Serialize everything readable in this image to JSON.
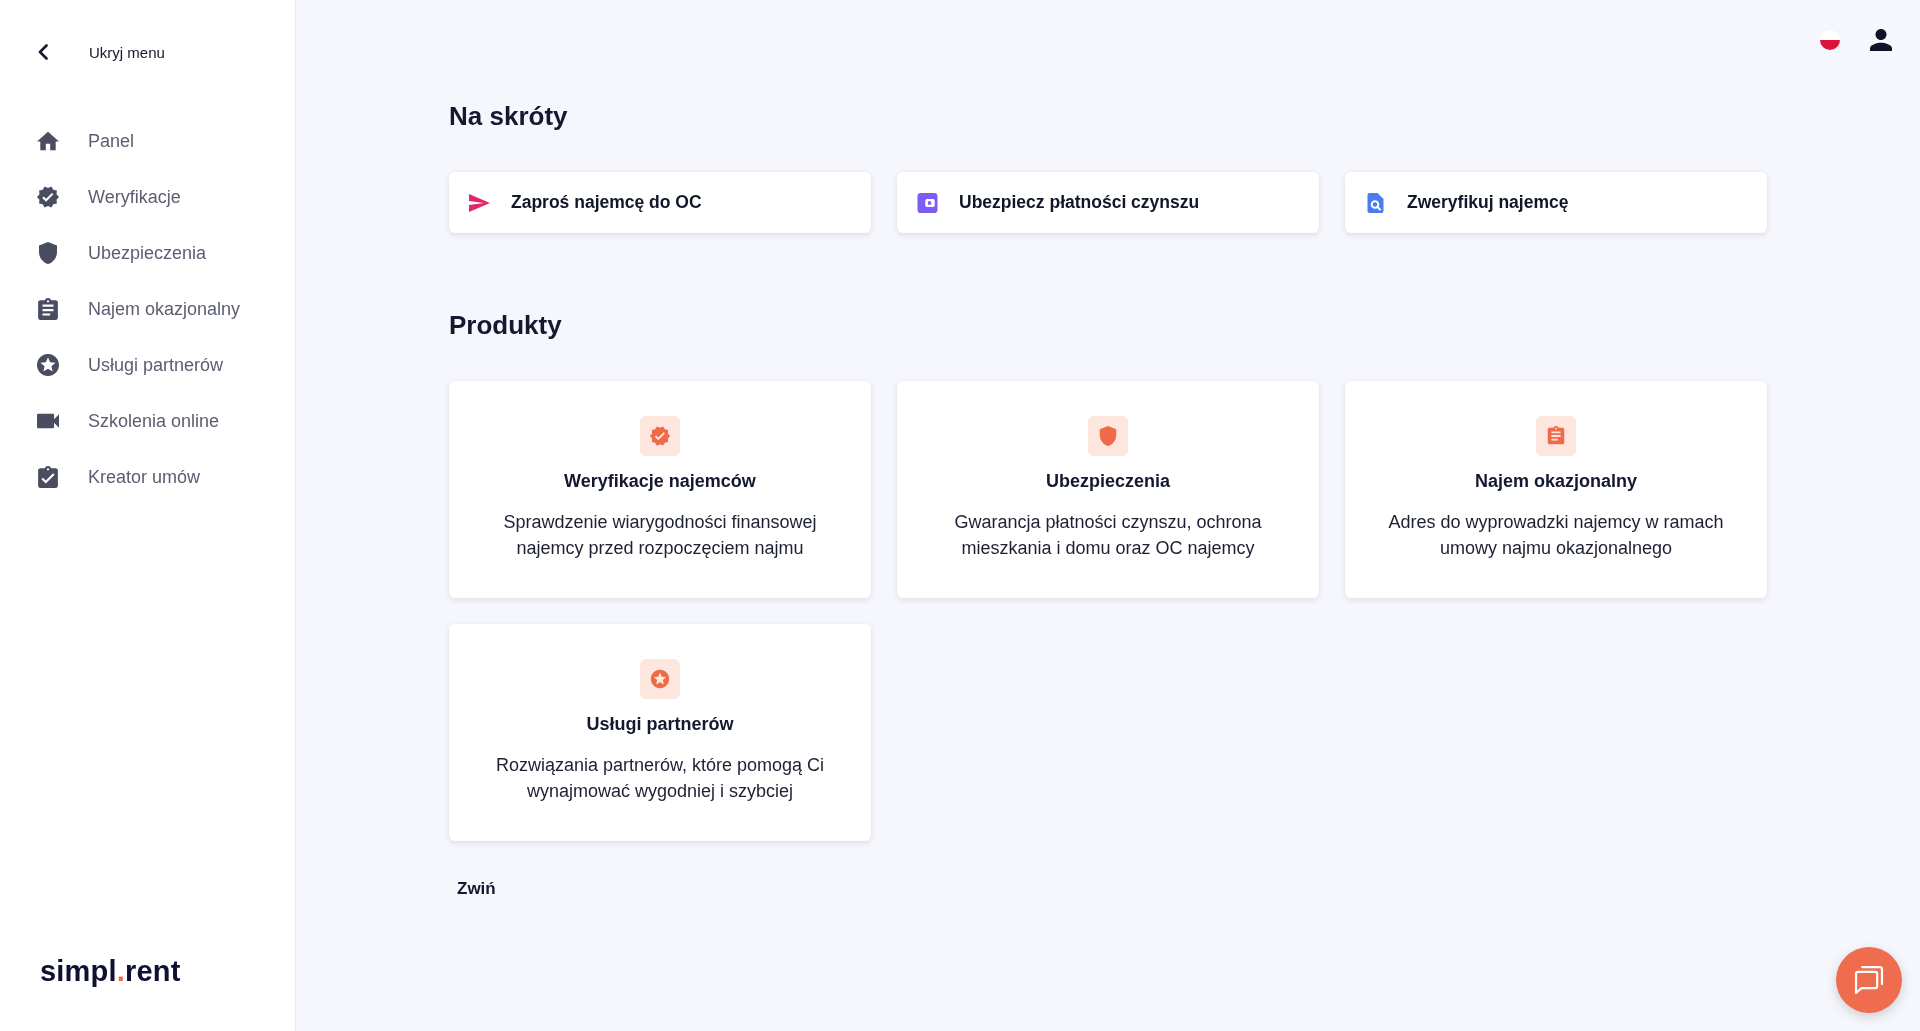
{
  "sidebar": {
    "toggle": "Ukryj menu",
    "items": [
      {
        "label": "Panel",
        "kind": "home"
      },
      {
        "label": "Weryfikacje",
        "kind": "verified"
      },
      {
        "label": "Ubezpieczenia",
        "kind": "shield"
      },
      {
        "label": "Najem okazjonalny",
        "kind": "clipboard"
      },
      {
        "label": "Usługi partnerów",
        "kind": "star"
      },
      {
        "label": "Szkolenia online",
        "kind": "video"
      },
      {
        "label": "Kreator umów",
        "kind": "checklist"
      }
    ],
    "logo": [
      {
        "text": "simpl",
        "accent": false
      },
      {
        "text": ".",
        "accent": true
      },
      {
        "text": "rent",
        "accent": false
      }
    ]
  },
  "shortcuts": {
    "title": "Na skróty",
    "items": [
      {
        "label": "Zaproś najemcę do OC",
        "kind": "send"
      },
      {
        "label": "Ubezpiecz płatności czynszu",
        "kind": "wallet"
      },
      {
        "label": "Zweryfikuj najemcę",
        "kind": "search"
      }
    ]
  },
  "products": {
    "title": "Produkty",
    "items": [
      {
        "title": "Weryfikacje najemców",
        "description": "Sprawdzenie wiarygodności finansowej najemcy przed rozpoczęciem najmu",
        "kind": "verified"
      },
      {
        "title": "Ubezpieczenia",
        "description": "Gwarancja płatności czynszu, ochrona mieszkania i domu oraz OC najemcy",
        "kind": "shield"
      },
      {
        "title": "Najem okazjonalny",
        "description": "Adres do wyprowadzki najemcy w ramach umowy najmu okazjonalnego",
        "kind": "clipboard"
      },
      {
        "title": "Usługi partnerów",
        "description": "Rozwiązania partnerów, które pomogą Ci wynajmować wygodniej i szybciej",
        "kind": "star"
      }
    ],
    "collapse": "Zwiń"
  }
}
